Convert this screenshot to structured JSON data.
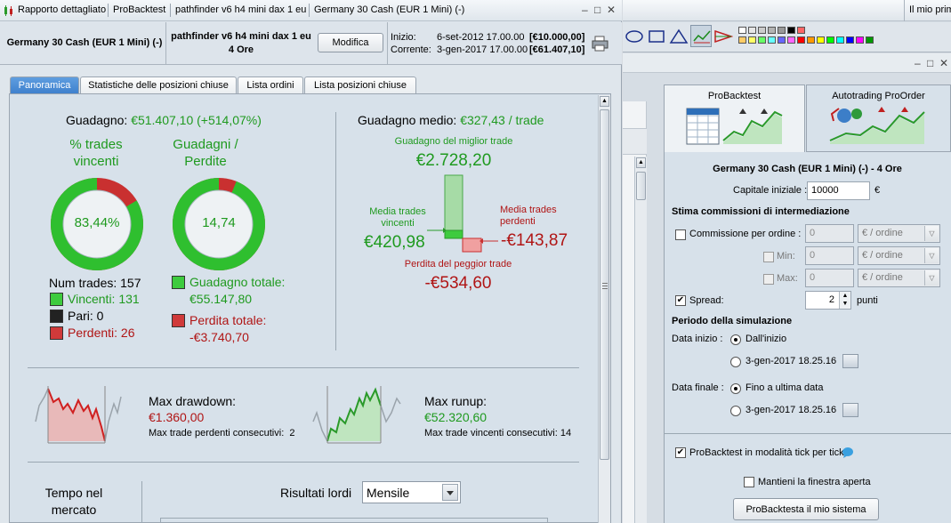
{
  "left": {
    "title_items": [
      "Rapporto dettagliato",
      "ProBacktest",
      "pathfinder v6 h4 mini dax 1 eu",
      "Germany 30 Cash (EUR 1 Mini) (-)"
    ],
    "instrument": "Germany 30 Cash (EUR 1 Mini) (-)",
    "system_name": "pathfinder v6 h4 mini dax 1 eu",
    "system_tf": "4 Ore",
    "modify_label": "Modifica",
    "start_label": "Inizio:",
    "start_date": "6-set-2012 17.00.00",
    "start_value": "[€10.000,00]",
    "current_label": "Corrente:",
    "current_date": "3-gen-2017 17.00.00",
    "current_value": "[€61.407,10]",
    "tabs": [
      "Panoramica",
      "Statistiche delle posizioni chiuse",
      "Lista ordini",
      "Lista posizioni chiuse"
    ],
    "gain_label": "Guadagno:",
    "gain_value": "€51.407,10 (+514,07%)",
    "pct_win_title_1": "% trades",
    "pct_win_title_2": "vincenti",
    "pct_win_value": "83,44%",
    "pct_win_fraction": 0.8344,
    "gl_title_1": "Guadagni /",
    "gl_title_2": "Perdite",
    "gl_value": "14,74",
    "gl_fraction": 0.9365,
    "num_trades": "Num trades: 157",
    "winners": "Vincenti: 131",
    "even": "Pari: 0",
    "losers": "Perdenti: 26",
    "total_gain_label": "Guadagno totale:",
    "total_gain_value": "€55.147,80",
    "total_loss_label": "Perdita totale:",
    "total_loss_value": "-€3.740,70",
    "avg_gain_label": "Guadagno medio:",
    "avg_gain_value": "€327,43 / trade",
    "best_trade_label": "Guadagno del miglior trade",
    "best_trade_value": "€2.728,20",
    "avg_win_label_1": "Media trades",
    "avg_win_label_2": "vincenti",
    "avg_win_value": "€420,98",
    "avg_loss_label_1": "Media trades",
    "avg_loss_label_2": "perdenti",
    "avg_loss_value": "-€143,87",
    "worst_trade_label": "Perdita del peggior trade",
    "worst_trade_value": "-€534,60",
    "max_dd_label": "Max drawdown:",
    "max_dd_value": "€1.360,00",
    "max_loss_consec": "Max trade perdenti consecutivi:  2",
    "max_runup_label": "Max runup:",
    "max_runup_value": "€52.320,60",
    "max_win_consec": "Max trade vincenti consecutivi: 14",
    "time_in_market_1": "Tempo nel",
    "time_in_market_2": "mercato",
    "gross_results": "Risultati lordi",
    "period_select": "Mensile"
  },
  "right": {
    "title": "Il mio prim",
    "tab_backtest": "ProBacktest",
    "tab_autotrading": "Autotrading ProOrder",
    "instrument": "Germany 30 Cash (EUR 1 Mini) (-) - 4 Ore",
    "capital_label": "Capitale iniziale :",
    "capital_value": "10000",
    "currency": "€",
    "commissions_title": "Stima commissioni di intermediazione",
    "commission_per_order": "Commissione per ordine :",
    "min_label": "Min:",
    "max_label": "Max:",
    "zero": "0",
    "unit_option": "€ / ordine",
    "spread_label": "Spread:",
    "spread_value": "2",
    "points": "punti",
    "sim_period": "Periodo della simulazione",
    "start_date_label": "Data inizio :",
    "from_start": "Dall'inizio",
    "start_date_value": "3-gen-2017 18.25.16",
    "end_date_label": "Data finale :",
    "to_last": "Fino a ultima data",
    "end_date_value": "3-gen-2017 18.25.16",
    "tick_mode": "ProBacktest in modalità tick per tick",
    "keep_open": "Mantieni la finestra aperta",
    "run_button": "ProBacktesta il mio sistema"
  },
  "colors": {
    "win": "#2fbf2f",
    "loss": "#c93030",
    "accent": "#3d7fcc"
  },
  "toolbar_icons": [
    "lasso-icon",
    "rectangle-icon",
    "triangle-icon",
    "trend-icon",
    "fibonacci-icon"
  ],
  "palette": [
    "#ffffff",
    "#e6e6e6",
    "#cccccc",
    "#b3b3b3",
    "#999999",
    "#000000",
    "#ff6666",
    "#ffcc66",
    "#ffff66",
    "#66ff66",
    "#66ffff",
    "#6666ff",
    "#ff66ff",
    "#ff0000",
    "#ff9900",
    "#ffff00",
    "#00ff00",
    "#00ffff",
    "#0000ff",
    "#ff00ff",
    "#009900"
  ]
}
